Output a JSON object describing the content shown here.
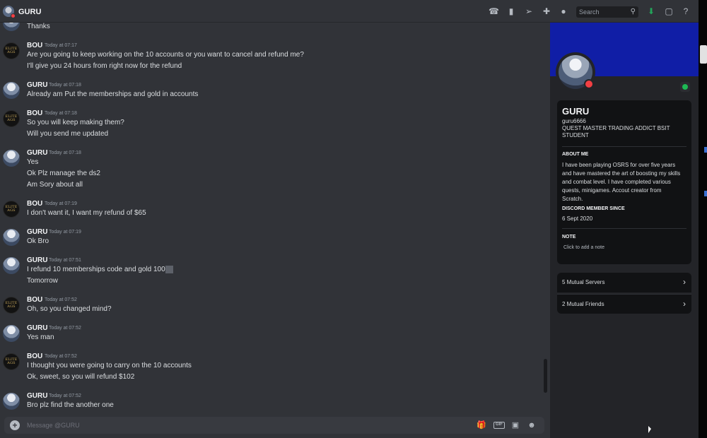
{
  "topbar": {
    "title": "GURU",
    "search_placeholder": "Search",
    "icons": [
      "phone-call-icon",
      "video-icon",
      "pin-icon",
      "add-friend-icon",
      "profile-toggle-icon",
      "search-icon",
      "download-icon",
      "inbox-icon",
      "help-icon"
    ]
  },
  "messages": [
    {
      "author": "",
      "time": "",
      "lines": [
        "Thanks"
      ]
    },
    {
      "author": "BOU",
      "time": "Today at 07:17",
      "lines": [
        "Are you going to keep working on the 10 accounts or you want to cancel and refund me?",
        "I'll give you 24 hours from right now for the refund"
      ]
    },
    {
      "author": "GURU",
      "time": "Today at 07:18",
      "lines": [
        "Already am Put the memberships and gold in accounts"
      ]
    },
    {
      "author": "BOU",
      "time": "Today at 07:18",
      "lines": [
        "So you will keep making them?",
        "Will you send me updated"
      ]
    },
    {
      "author": "GURU",
      "time": "Today at 07:18",
      "lines": [
        "Yes",
        "Ok Plz manage the ds2",
        "Am Sory about all"
      ]
    },
    {
      "author": "BOU",
      "time": "Today at 07:19",
      "lines": [
        "I don't want it, I want my refund of $65"
      ]
    },
    {
      "author": "GURU",
      "time": "Today at 07:19",
      "lines": [
        "Ok Bro"
      ]
    },
    {
      "author": "GURU",
      "time": "Today at 07:51",
      "lines": [
        "I refund 10 memberships code  and gold 100",
        "Tomorrow"
      ]
    },
    {
      "author": "BOU",
      "time": "Today at 07:52",
      "lines": [
        "Oh, so you changed mind?"
      ]
    },
    {
      "author": "GURU",
      "time": "Today at 07:52",
      "lines": [
        "Yes man"
      ]
    },
    {
      "author": "BOU",
      "time": "Today at 07:52",
      "lines": [
        "I thought you were going to carry on the 10 accounts",
        "Ok, sweet, so you will refund $102"
      ]
    },
    {
      "author": "GURU",
      "time": "Today at 07:52",
      "lines": [
        "Bro plz find the another one"
      ]
    }
  ],
  "bou_avatar_text": "ELITE AGS",
  "composer": {
    "placeholder": "Message @GURU",
    "gif_label": "GIF"
  },
  "profile": {
    "display_name": "GURU",
    "username": "guru6666",
    "tagline": "QUEST MASTER TRADING ADDICT BSIT STUDENT",
    "about_heading": "ABOUT ME",
    "about_text": "I have been playing OSRS for over five years and have mastered the art of boosting my skills and combat level. I have completed various quests, minigames. Accout creator from Scratch.",
    "since_heading": "DISCORD MEMBER SINCE",
    "since_value": "6 Sept 2020",
    "note_heading": "NOTE",
    "note_placeholder": "Click to add a note",
    "mutual_servers": "5 Mutual Servers",
    "mutual_friends": "2 Mutual Friends"
  },
  "colors": {
    "banner": "#101ea6",
    "dnd": "#f23f43",
    "spotify": "#1db954",
    "background": "#313338"
  }
}
